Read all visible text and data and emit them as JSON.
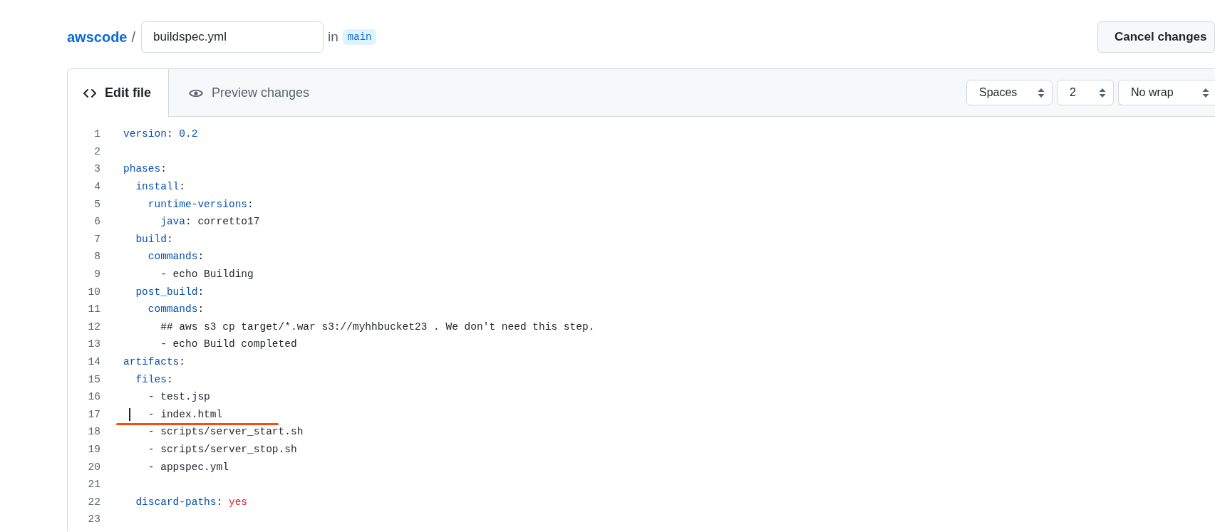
{
  "breadcrumb": {
    "repo": "awscode",
    "separator": "/",
    "filename": "buildspec.yml",
    "in_label": "in",
    "branch": "main"
  },
  "cancel_button": "Cancel changes",
  "tabs": [
    {
      "label": "Edit file",
      "selected": true
    },
    {
      "label": "Preview changes",
      "selected": false
    }
  ],
  "selects": [
    {
      "value": "Spaces"
    },
    {
      "value": "2"
    },
    {
      "value": "No wrap"
    }
  ],
  "lines": [
    {
      "number": "1",
      "tokens": [
        {
          "kind": "key",
          "text": "version"
        },
        {
          "kind": "plain",
          "text": ": "
        },
        {
          "kind": "number",
          "text": "0.2"
        }
      ]
    },
    {
      "number": "2"
    },
    {
      "number": "3",
      "tokens": [
        {
          "kind": "key",
          "text": "phases"
        },
        {
          "kind": "plain",
          "text": ":"
        }
      ]
    },
    {
      "number": "4",
      "tokens": [
        {
          "kind": "key",
          "text": "  install"
        },
        {
          "kind": "plain",
          "text": ":"
        }
      ]
    },
    {
      "number": "5",
      "tokens": [
        {
          "kind": "key",
          "text": "    runtime-versions"
        },
        {
          "kind": "plain",
          "text": ":"
        }
      ]
    },
    {
      "number": "6",
      "tokens": [
        {
          "kind": "key",
          "text": "      java"
        },
        {
          "kind": "plain",
          "text": ": corretto17"
        }
      ]
    },
    {
      "number": "7",
      "tokens": [
        {
          "kind": "key",
          "text": "  build"
        },
        {
          "kind": "plain",
          "text": ":"
        }
      ]
    },
    {
      "number": "8",
      "tokens": [
        {
          "kind": "key",
          "text": "    commands"
        },
        {
          "kind": "plain",
          "text": ":"
        }
      ]
    },
    {
      "number": "9",
      "tokens": [
        {
          "kind": "plain",
          "text": "      - echo Building"
        }
      ]
    },
    {
      "number": "10",
      "tokens": [
        {
          "kind": "key",
          "text": "  post_build"
        },
        {
          "kind": "plain",
          "text": ":"
        }
      ]
    },
    {
      "number": "11",
      "tokens": [
        {
          "kind": "key",
          "text": "    commands"
        },
        {
          "kind": "plain",
          "text": ":"
        }
      ]
    },
    {
      "number": "12",
      "tokens": [
        {
          "kind": "plain",
          "text": "      ## aws s3 cp target/*.war s3://myhhbucket23 . We don't need this step."
        }
      ]
    },
    {
      "number": "13",
      "tokens": [
        {
          "kind": "plain",
          "text": "      - echo Build completed"
        }
      ]
    },
    {
      "number": "14",
      "tokens": [
        {
          "kind": "key",
          "text": "artifacts"
        },
        {
          "kind": "plain",
          "text": ":"
        }
      ]
    },
    {
      "number": "15",
      "tokens": [
        {
          "kind": "key",
          "text": "  files"
        },
        {
          "kind": "plain",
          "text": ":"
        }
      ]
    },
    {
      "number": "16",
      "tokens": [
        {
          "kind": "plain",
          "text": "    - test.jsp"
        }
      ]
    },
    {
      "number": "17",
      "cursor": true,
      "underlined": true,
      "tokens": [
        {
          "kind": "plain",
          "text": "    - index.html"
        }
      ]
    },
    {
      "number": "18",
      "tokens": [
        {
          "kind": "plain",
          "text": "    - scripts/server_start.sh"
        }
      ]
    },
    {
      "number": "19",
      "tokens": [
        {
          "kind": "plain",
          "text": "    - scripts/server_stop.sh"
        }
      ]
    },
    {
      "number": "20",
      "tokens": [
        {
          "kind": "plain",
          "text": "    - appspec.yml"
        }
      ]
    },
    {
      "number": "21"
    },
    {
      "number": "22",
      "tokens": [
        {
          "kind": "key",
          "text": "  discard-paths"
        },
        {
          "kind": "plain",
          "text": ": "
        },
        {
          "kind": "bool",
          "text": "yes"
        }
      ]
    },
    {
      "number": "23"
    }
  ]
}
